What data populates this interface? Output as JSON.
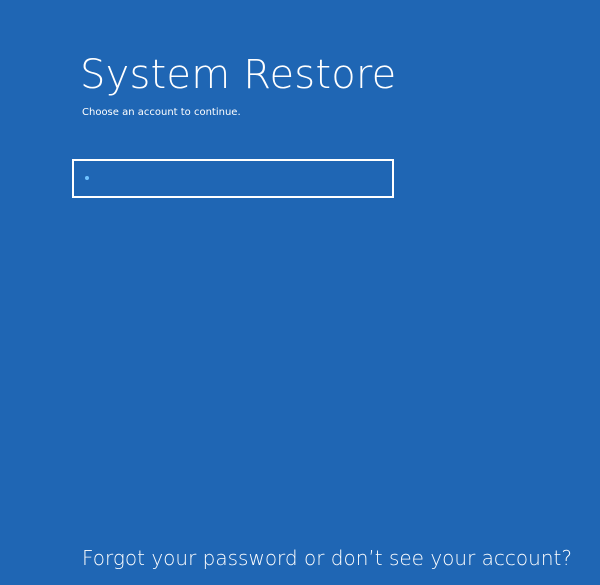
{
  "screen": {
    "title": "System Restore",
    "instruction": "Choose an account to continue.",
    "account": {
      "name": ""
    },
    "help_link": "Forgot your password or don’t see your account?"
  },
  "colors": {
    "background": "#1f66b4",
    "text": "#ffffff",
    "account_dot": "#6fc3ff"
  },
  "icons": {
    "account": "account-dot-icon"
  }
}
